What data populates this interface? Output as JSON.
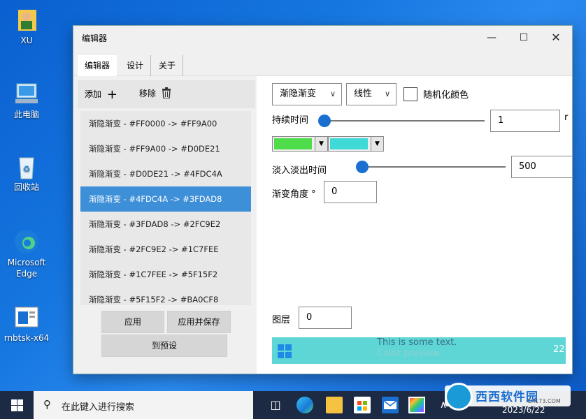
{
  "desktop": {
    "icons": [
      {
        "label": "XU"
      },
      {
        "label": "此电脑"
      },
      {
        "label": "回收站"
      },
      {
        "label": "Microsoft Edge"
      },
      {
        "label": "rnbtsk-x64"
      }
    ]
  },
  "window": {
    "title": "编辑器",
    "tabs": [
      {
        "label": "编辑器"
      },
      {
        "label": "设计"
      },
      {
        "label": "关于"
      }
    ]
  },
  "left": {
    "add_label": "添加",
    "remove_label": "移除",
    "items": [
      {
        "label": "渐隐渐变 - #FF0000 -> #FF9A00"
      },
      {
        "label": "渐隐渐变 - #FF9A00 -> #D0DE21"
      },
      {
        "label": "渐隐渐变 - #D0DE21 -> #4FDC4A"
      },
      {
        "label": "渐隐渐变 - #4FDC4A -> #3FDAD8"
      },
      {
        "label": "渐隐渐变 - #3FDAD8 -> #2FC9E2"
      },
      {
        "label": "渐隐渐变 - #2FC9E2 -> #1C7FEE"
      },
      {
        "label": "渐隐渐变 - #1C7FEE -> #5F15F2"
      },
      {
        "label": "渐隐渐变 - #5F15F2 -> #BA0CF8"
      }
    ],
    "selected_index": 3,
    "apply_label": "应用",
    "apply_save_label": "应用并保存",
    "preset_label": "到预设"
  },
  "right": {
    "effect_value": "渐隐渐变",
    "mode_value": "线性",
    "random_label": "随机化颜色",
    "random_checked": false,
    "duration_label": "持续时间",
    "duration_value": "1",
    "duration_unit": "r",
    "color1": "#4FDC4A",
    "color2": "#3FDAD8",
    "fade_label": "淡入淡出时间",
    "fade_value": "500",
    "angle_label": "渐变角度 °",
    "angle_value": "0",
    "layer_label": "图层",
    "layer_value": "0",
    "preview_text": "This is some text.",
    "preview_sub": "Color preview.",
    "preview_num": "22"
  },
  "taskbar": {
    "search_placeholder": "在此键入进行搜索",
    "date": "2023/6/22"
  },
  "watermark": {
    "brand": "西西软件园",
    "site": "CR173.COM"
  }
}
